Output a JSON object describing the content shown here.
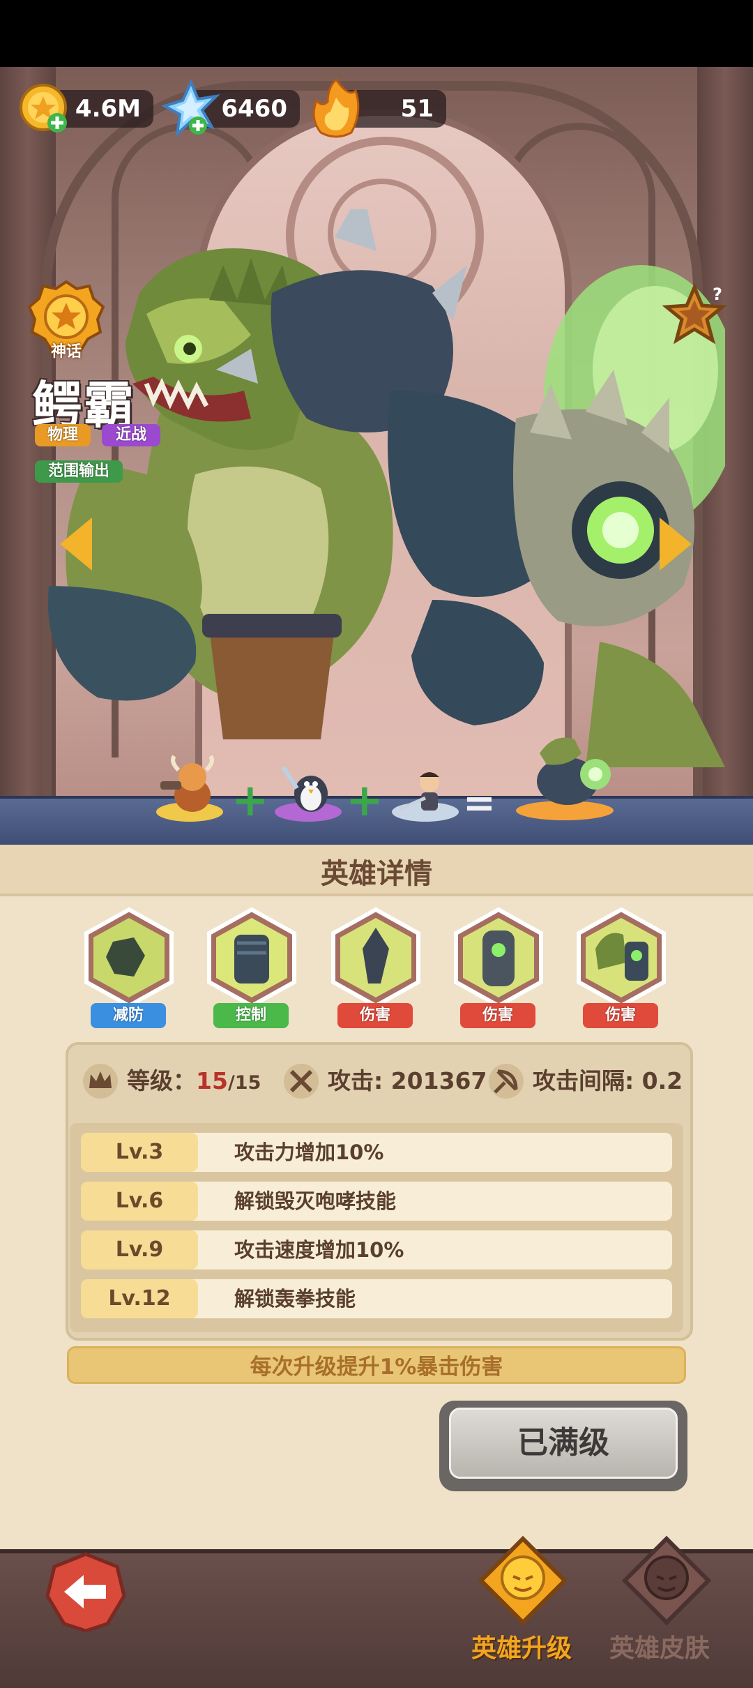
{
  "currency": {
    "gold": "4.6M",
    "gems": "6460",
    "shards": "51"
  },
  "hero": {
    "rarity": "神话",
    "name": "鳄霸",
    "tags": {
      "damage_type": "物理",
      "range": "近战",
      "role": "范围输出"
    }
  },
  "details": {
    "title": "英雄详情",
    "skills": [
      {
        "label": "减防",
        "icon": "crushed-stone-icon",
        "color": "#3a8fe0"
      },
      {
        "label": "控制",
        "icon": "fist-icon",
        "color": "#4bb84a"
      },
      {
        "label": "伤害",
        "icon": "crystal-shard-icon",
        "color": "#e04a3a"
      },
      {
        "label": "伤害",
        "icon": "golem-icon",
        "color": "#e04a3a"
      },
      {
        "label": "伤害",
        "icon": "croc-fist-icon",
        "color": "#e04a3a"
      }
    ],
    "stats": {
      "level_label": "等级：",
      "level_current": "15",
      "level_max": "/15",
      "attack": "攻击: 201367",
      "interval": "攻击间隔: 0.2"
    },
    "levels": [
      {
        "lv": "Lv.3",
        "desc": "攻击力增加10%"
      },
      {
        "lv": "Lv.6",
        "desc": "解锁毁灭咆哮技能"
      },
      {
        "lv": "Lv.9",
        "desc": "攻击速度增加10%"
      },
      {
        "lv": "Lv.12",
        "desc": "解锁轰拳技能"
      }
    ],
    "bonus": "每次升级提升1%暴击伤害",
    "maxed_button": "已满级"
  },
  "tabs": {
    "upgrade": "英雄升级",
    "skin": "英雄皮肤"
  },
  "colors": {
    "accent_gold": "#f0a020",
    "tab_active": "#f3a51f",
    "tab_inactive": "#8a6a60"
  }
}
